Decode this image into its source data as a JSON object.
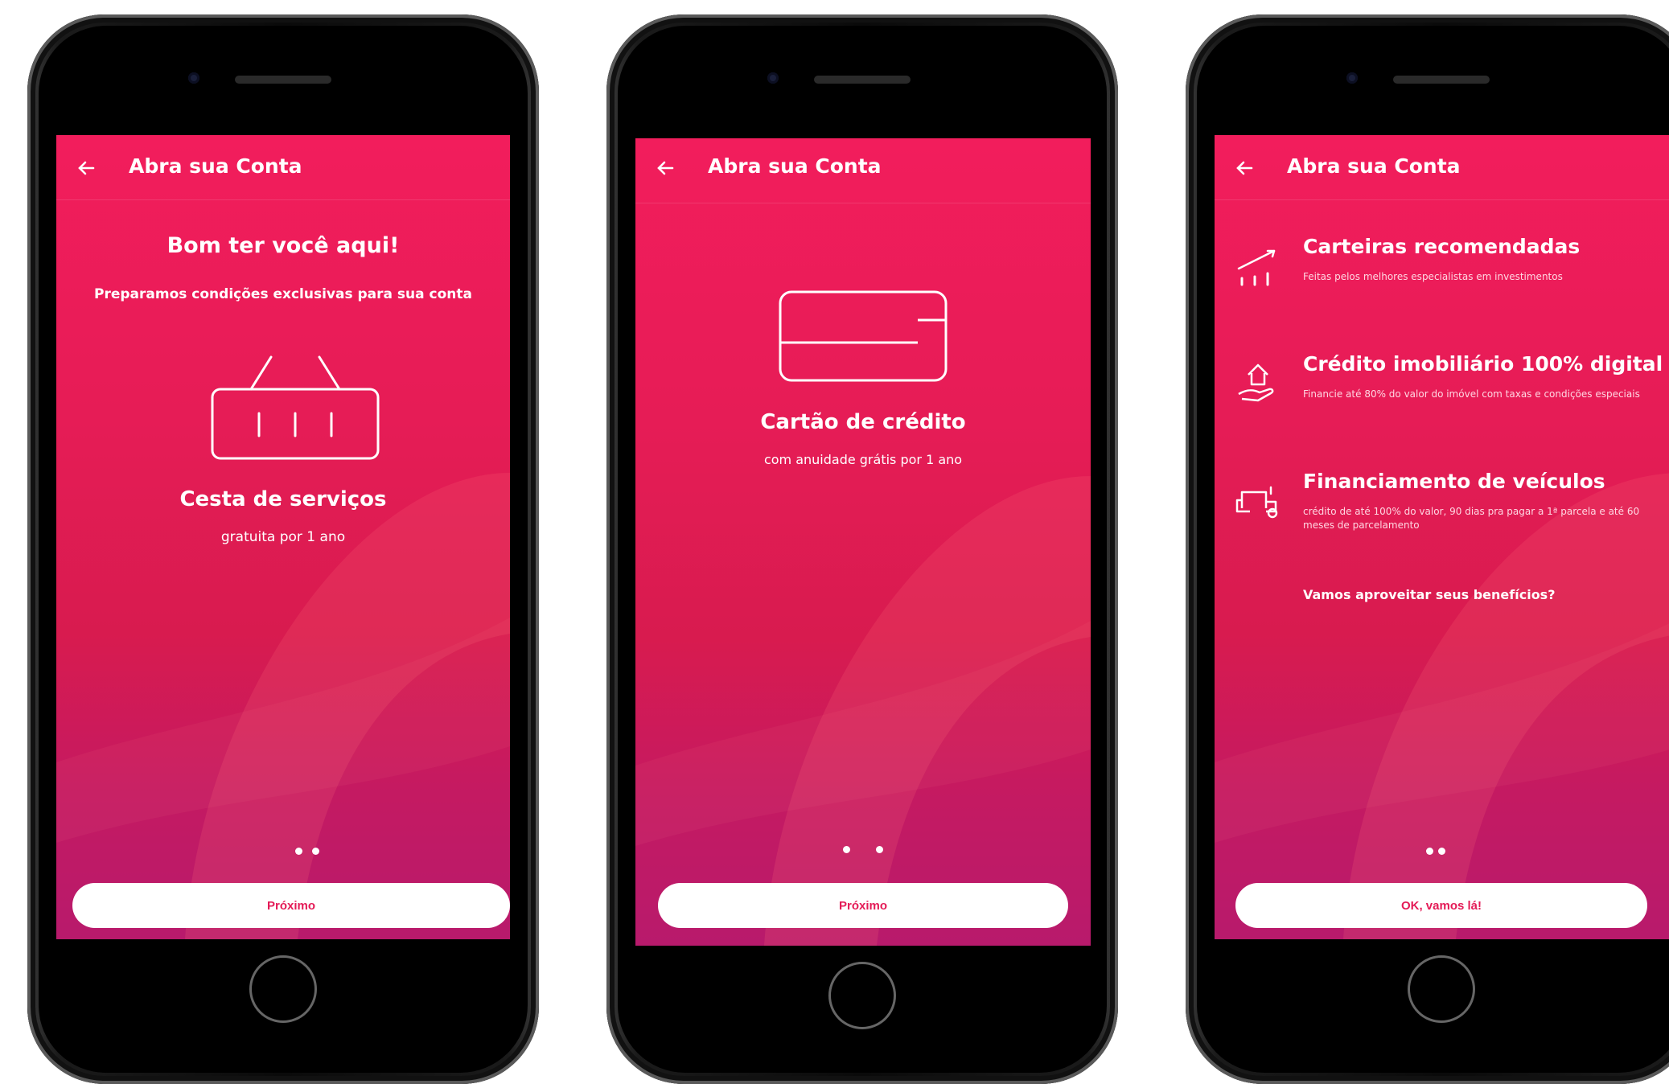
{
  "colors": {
    "accent": "#f21d5c",
    "cta_text": "#e41b57"
  },
  "screens": [
    {
      "topbar": {
        "back_icon": "arrow-left-icon",
        "title": "Abra sua Conta"
      },
      "heading": "Bom ter você aqui!",
      "subheading": "Preparamos condições exclusivas para sua conta",
      "illustration": "basket-icon",
      "item_title": "Cesta de serviços",
      "item_subtitle": "gratuita por 1 ano",
      "button": "Próximo"
    },
    {
      "topbar": {
        "back_icon": "arrow-left-icon",
        "title": "Abra sua Conta"
      },
      "illustration": "credit-card-icon",
      "item_title": "Cartão de crédito",
      "item_subtitle": "com anuidade grátis por 1 ano",
      "button": "Próximo"
    },
    {
      "topbar": {
        "back_icon": "arrow-left-icon",
        "title": "Abra sua Conta"
      },
      "benefits": [
        {
          "icon": "trend-chart-icon",
          "title": "Carteiras recomendadas",
          "desc": "Feitas pelos melhores especialistas em investimentos"
        },
        {
          "icon": "house-hand-icon",
          "title": "Crédito imobiliário 100% digital",
          "desc": "Financie até 80% do valor do imóvel com taxas e condições especiais"
        },
        {
          "icon": "truck-icon",
          "title": "Financiamento de veículos",
          "desc": "crédito de até 100% do valor, 90 dias pra pagar a 1ª parcela e até 60 meses de parcelamento"
        }
      ],
      "question": "Vamos aproveitar seus benefícios?",
      "button": "OK, vamos lá!"
    }
  ]
}
